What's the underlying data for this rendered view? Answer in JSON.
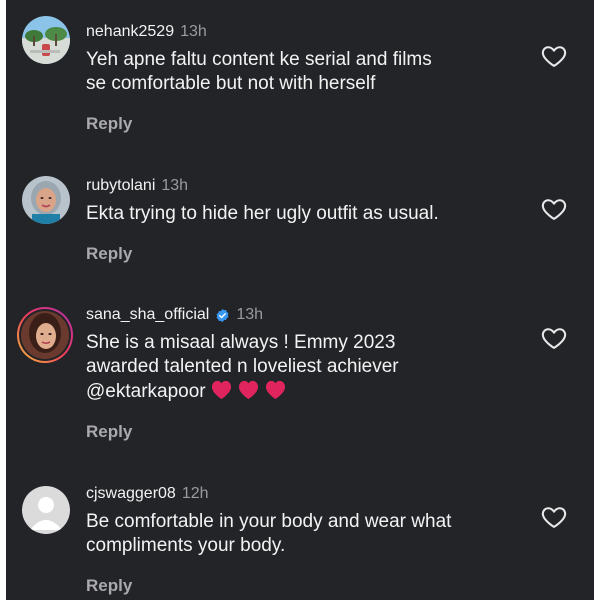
{
  "comments": [
    {
      "username": "nehank2529",
      "time": "13h",
      "text": "Yeh apne faltu content ke serial and films\nse comfortable but not with herself",
      "reply_label": "Reply",
      "avatar": "landscape-photo-avatar",
      "like_icon": "heart-outline-icon"
    },
    {
      "username": "rubytolani",
      "time": "13h",
      "text": "Ekta trying to hide her ugly outfit as usual.",
      "reply_label": "Reply",
      "avatar": "woman-photo-avatar",
      "like_icon": "heart-outline-icon"
    },
    {
      "username": "sana_sha_official",
      "verified": true,
      "time": "13h",
      "text": "She is a misaal always ! Emmy 2023\nawarded talented n loveliest achiever\n@ektarkapoor",
      "emojis": [
        "red-heart",
        "red-heart",
        "red-heart"
      ],
      "reply_label": "Reply",
      "avatar": "woman-photo-avatar-story-ring",
      "like_icon": "heart-outline-icon"
    },
    {
      "username": "cjswagger08",
      "time": "12h",
      "text": "Be comfortable in your body and wear what\ncompliments your body.",
      "reply_label": "Reply",
      "avatar": "default-profile-avatar",
      "like_icon": "heart-outline-icon"
    }
  ],
  "colors": {
    "background": "#232428",
    "text": "#f3f3f3",
    "muted": "#9a9a9f",
    "verified": "#3897f0",
    "heart_emoji": "#e0245e"
  }
}
